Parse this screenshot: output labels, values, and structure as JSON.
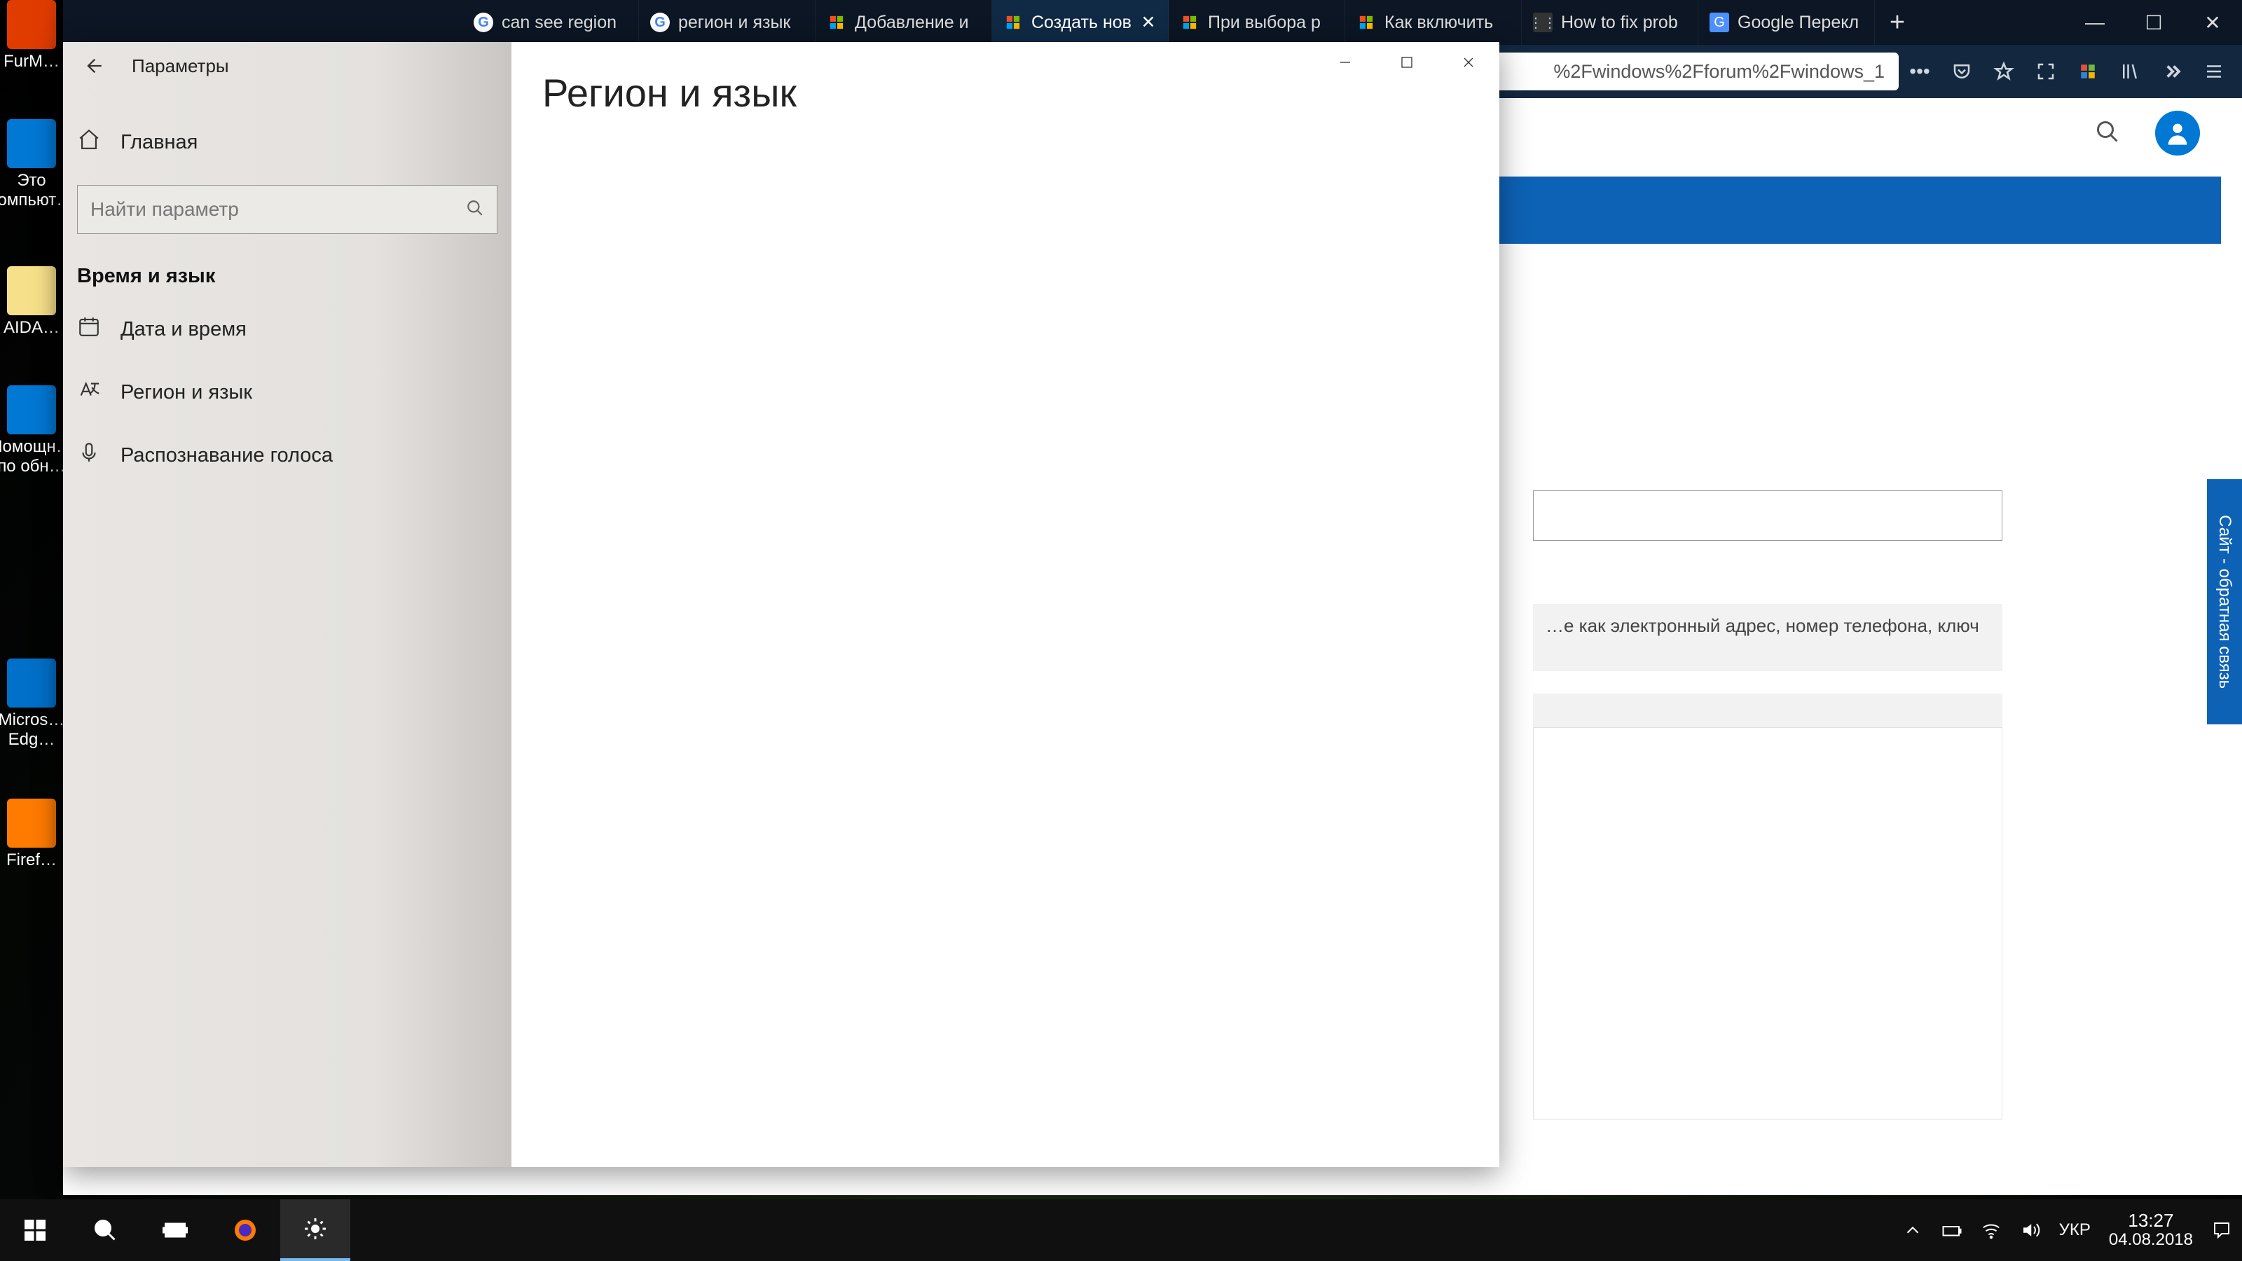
{
  "desktop_icons": [
    {
      "label": "FurM…",
      "color": "#e03c00"
    },
    {
      "label": "Это\nкомпьют…",
      "color": "#0078d4"
    },
    {
      "label": "AIDA…",
      "color": "#f7e08a"
    },
    {
      "label": "Помощн…\nпо обн…",
      "color": "#0078d4"
    },
    {
      "label": "Micros…\nEdg…",
      "color": "#0070c9"
    },
    {
      "label": "Firef…",
      "color": "#ff7b00"
    }
  ],
  "firefox": {
    "tabs": [
      {
        "label": "can see region",
        "favicon": "google"
      },
      {
        "label": "регион и язык",
        "favicon": "google"
      },
      {
        "label": "Добавление и",
        "favicon": "ms"
      },
      {
        "label": "Создать нов",
        "favicon": "ms",
        "active": true
      },
      {
        "label": "При выбора р",
        "favicon": "ms"
      },
      {
        "label": "Как включить",
        "favicon": "ms"
      },
      {
        "label": "How to fix prob",
        "favicon": "dots"
      },
      {
        "label": "Google Перекл",
        "favicon": "gt"
      }
    ],
    "url_visible": "%2Fwindows%2Fforum%2Fwindows_1",
    "page": {
      "gray_text": "…е как электронный адрес, номер телефона, ключ",
      "feedback_label": "Сайт - обратная связь"
    }
  },
  "settings": {
    "app_title": "Параметры",
    "search_placeholder": "Найти параметр",
    "home_label": "Главная",
    "group_label": "Время и язык",
    "items": [
      {
        "label": "Дата и время",
        "icon": "clock"
      },
      {
        "label": "Регион и язык",
        "icon": "lang",
        "selected": true
      },
      {
        "label": "Распознавание голоса",
        "icon": "mic"
      }
    ],
    "page_title": "Регион и язык"
  },
  "taskbar": {
    "lang": "УКР",
    "time": "13:27",
    "date": "04.08.2018"
  }
}
